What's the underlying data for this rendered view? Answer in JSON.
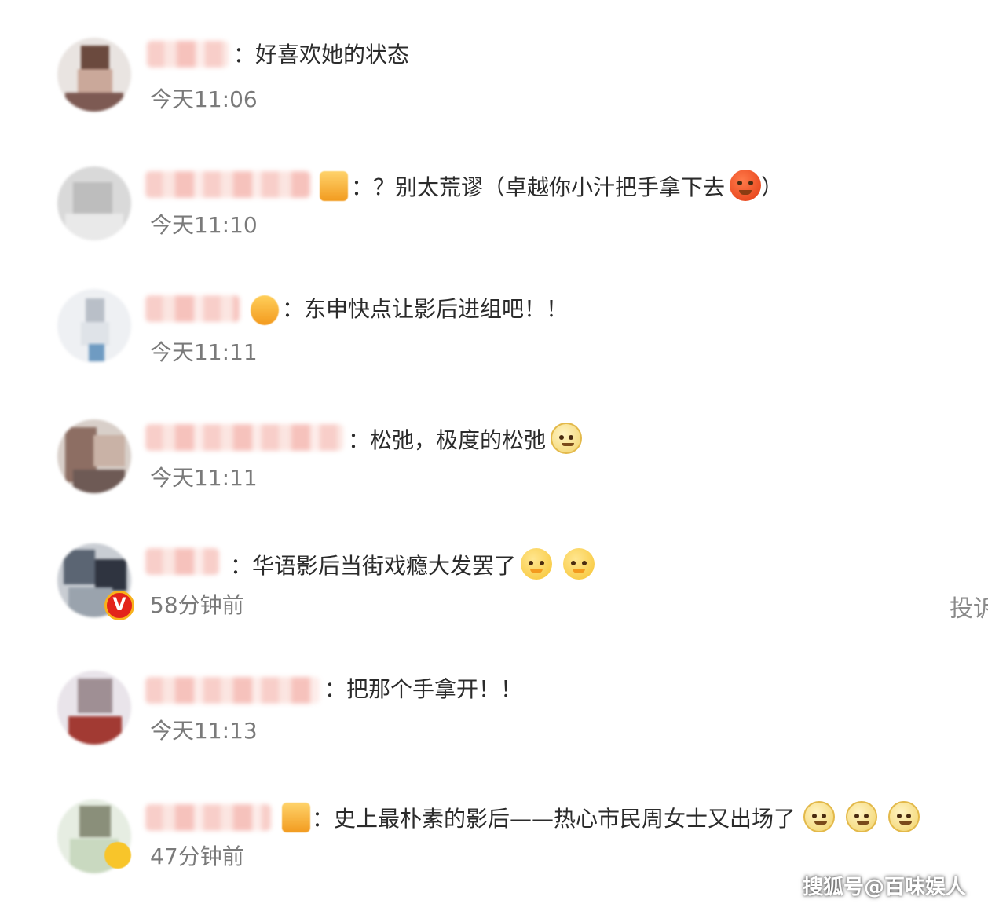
{
  "comments": [
    {
      "text": "：好喜欢她的状态",
      "time": "今天11:06"
    },
    {
      "text": "：？别太荒谬（卓越你小汁把手拿下去",
      "text_tail": "）",
      "time": "今天11:10"
    },
    {
      "text": "：东申快点让影后进组吧！！",
      "time": "今天11:11"
    },
    {
      "text": "：松弛，极度的松弛",
      "time": "今天11:11"
    },
    {
      "text": "：华语影后当街戏瘾大发罢了",
      "time": "58分钟前"
    },
    {
      "text": "：把那个手拿开！！",
      "time": "今天11:13"
    },
    {
      "text": "：史上最朴素的影后——热心市民周女士又出场了",
      "time": "47分钟前"
    }
  ],
  "emoji_names": [
    "angry-face-icon",
    "worried-face-icon",
    "dog-face-icon"
  ],
  "verified_badge": "V",
  "side_action": "投诉",
  "watermark": "搜狐号@百味娱人",
  "colors": {
    "text": "#2b2b2b",
    "time": "#7a7a7a",
    "verified": "#e3241b"
  }
}
